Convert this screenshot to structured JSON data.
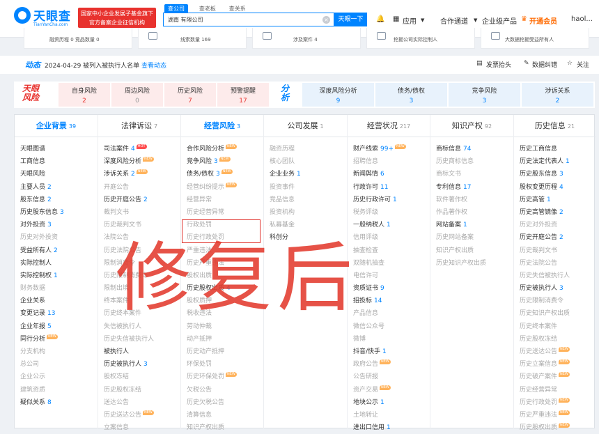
{
  "header": {
    "logo_text": "天眼查",
    "logo_sub": "TianYanCha.com",
    "badge_line1": "国家中小企业发展子基金旗下",
    "badge_line2": "官方备案企业征信机构",
    "search_tabs": [
      "查公司",
      "查老板",
      "查关系"
    ],
    "search_value": "湖南        有限公司",
    "search_button": "天眼一下",
    "nav": [
      "应用",
      "合作通道",
      "企业级产品",
      "开通会员",
      "haol..."
    ]
  },
  "stats": [
    "融资历程 0  竞品数量 0",
    "线索数量 169",
    "涉及案件 4",
    "挖掘公司实际控制人",
    "大数据挖掘受益所有人"
  ],
  "dynamic": {
    "title": "动态",
    "text": "2024-04-29 被列入被执行人名单",
    "link": "查看动态",
    "actions": [
      "发票抬头",
      "数据纠错",
      "关注"
    ]
  },
  "risk": {
    "logo_line1": "天眼",
    "logo_line2": "风险",
    "items": [
      {
        "label": "自身风险",
        "value": "2"
      },
      {
        "label": "周边风险",
        "value": "0"
      },
      {
        "label": "历史风险",
        "value": "7"
      },
      {
        "label": "预警提醒",
        "value": "17"
      }
    ],
    "ana_line1": "分",
    "ana_line2": "析",
    "analysis": [
      {
        "label": "深度风险分析",
        "value": "9"
      },
      {
        "label": "债务/债权",
        "value": "3"
      },
      {
        "label": "竞争风险",
        "value": "3"
      },
      {
        "label": "涉诉关系",
        "value": "2"
      }
    ]
  },
  "columns": [
    {
      "title": "企业背景",
      "count": "39",
      "active": true,
      "items": [
        {
          "t": "天眼图谱"
        },
        {
          "t": "工商信息"
        },
        {
          "t": "天眼风险"
        },
        {
          "t": "主要人员",
          "n": "2"
        },
        {
          "t": "股东信息",
          "n": "2"
        },
        {
          "t": "历史股东信息",
          "n": "3"
        },
        {
          "t": "对外投资",
          "n": "3"
        },
        {
          "t": "历史对外投资",
          "d": true
        },
        {
          "t": "受益所有人",
          "n": "2"
        },
        {
          "t": "实际控制人"
        },
        {
          "t": "实际控制权",
          "n": "1"
        },
        {
          "t": "财务数据",
          "d": true
        },
        {
          "t": "企业关系"
        },
        {
          "t": "变更记录",
          "n": "13"
        },
        {
          "t": "企业年报",
          "n": "5"
        },
        {
          "t": "同行分析",
          "new": true
        },
        {
          "t": "分支机构",
          "d": true
        },
        {
          "t": "总公司",
          "d": true
        },
        {
          "t": "企业公示",
          "d": true
        },
        {
          "t": "建筑资质",
          "d": true
        },
        {
          "t": "疑似关系",
          "n": "8"
        }
      ]
    },
    {
      "title": "法律诉讼",
      "count": "7",
      "items": [
        {
          "t": "司法案件",
          "n": "4",
          "hot": true
        },
        {
          "t": "深度风险分析",
          "new": true
        },
        {
          "t": "涉诉关系",
          "n": "2",
          "new": true
        },
        {
          "t": "开庭公告",
          "d": true
        },
        {
          "t": "历史开庭公告",
          "n": "2"
        },
        {
          "t": "裁判文书",
          "d": true
        },
        {
          "t": "历史裁判文书",
          "d": true
        },
        {
          "t": "法院公告",
          "d": true
        },
        {
          "t": "历史法院公告",
          "d": true
        },
        {
          "t": "限制消费令",
          "d": true
        },
        {
          "t": "历史限制消费令",
          "d": true
        },
        {
          "t": "限制出境",
          "d": true
        },
        {
          "t": "终本案件",
          "d": true
        },
        {
          "t": "历史终本案件",
          "d": true
        },
        {
          "t": "失信被执行人",
          "d": true
        },
        {
          "t": "历史失信被执行人",
          "d": true
        },
        {
          "t": "被执行人"
        },
        {
          "t": "历史被执行人",
          "n": "3"
        },
        {
          "t": "股权冻结",
          "d": true
        },
        {
          "t": "历史股权冻结",
          "d": true
        },
        {
          "t": "送达公告",
          "d": true
        },
        {
          "t": "历史送达公告",
          "d": true,
          "new": true
        },
        {
          "t": "立案信息",
          "d": true
        }
      ]
    },
    {
      "title": "经营风险",
      "count": "3",
      "active": true,
      "items": [
        {
          "t": "合作风险分析",
          "new": true
        },
        {
          "t": "竞争风险",
          "n": "3",
          "new": true
        },
        {
          "t": "债务/债权",
          "n": "3",
          "new": true
        },
        {
          "t": "经营纠纷提示",
          "d": true,
          "new": true
        },
        {
          "t": "经营异常",
          "d": true
        },
        {
          "t": "历史经营异常",
          "d": true
        },
        {
          "t": "行政处罚",
          "d": true
        },
        {
          "t": "历史行政处罚",
          "d": true
        },
        {
          "t": "严重违法",
          "d": true
        },
        {
          "t": "历史严重违法",
          "d": true
        },
        {
          "t": "股权出质",
          "d": true
        },
        {
          "t": "历史股权出质",
          "n": "4"
        },
        {
          "t": "股权质押",
          "d": true
        },
        {
          "t": "税收违法",
          "d": true
        },
        {
          "t": "劳动仲裁",
          "d": true
        },
        {
          "t": "动产抵押",
          "d": true
        },
        {
          "t": "历史动产抵押",
          "d": true
        },
        {
          "t": "环保处罚",
          "d": true
        },
        {
          "t": "历史环保处罚",
          "d": true,
          "new": true
        },
        {
          "t": "欠税公告",
          "d": true
        },
        {
          "t": "历史欠税公告",
          "d": true
        },
        {
          "t": "清算信息",
          "d": true
        },
        {
          "t": "知识产权出质",
          "d": true
        }
      ]
    },
    {
      "title": "公司发展",
      "count": "1",
      "items": [
        {
          "t": "融资历程",
          "d": true
        },
        {
          "t": "核心团队",
          "d": true
        },
        {
          "t": "企业业务",
          "n": "1"
        },
        {
          "t": "投资事件",
          "d": true
        },
        {
          "t": "竞品信息",
          "d": true
        },
        {
          "t": "投资机构",
          "d": true
        },
        {
          "t": "私募基金",
          "d": true
        },
        {
          "t": "科创分"
        }
      ]
    },
    {
      "title": "经营状况",
      "count": "217",
      "items": [
        {
          "t": "财产线索",
          "n": "99+",
          "new": true
        },
        {
          "t": "招聘信息",
          "d": true
        },
        {
          "t": "新闻舆情",
          "n": "6"
        },
        {
          "t": "行政许可",
          "n": "11"
        },
        {
          "t": "历史行政许可",
          "n": "1"
        },
        {
          "t": "税务评级",
          "d": true
        },
        {
          "t": "一般纳税人",
          "n": "1"
        },
        {
          "t": "信用评级",
          "d": true
        },
        {
          "t": "抽查检查",
          "d": true
        },
        {
          "t": "双随机抽查",
          "d": true
        },
        {
          "t": "电信许可",
          "d": true
        },
        {
          "t": "资质证书",
          "n": "9"
        },
        {
          "t": "招投标",
          "n": "14"
        },
        {
          "t": "产品信息",
          "d": true
        },
        {
          "t": "微信公众号",
          "d": true
        },
        {
          "t": "微博",
          "d": true
        },
        {
          "t": "抖音/快手",
          "n": "1"
        },
        {
          "t": "政府公告",
          "d": true,
          "new": true
        },
        {
          "t": "公告研报",
          "d": true
        },
        {
          "t": "资产交易",
          "d": true,
          "new": true
        },
        {
          "t": "地块公示",
          "n": "1"
        },
        {
          "t": "土地转让",
          "d": true
        },
        {
          "t": "进出口信用",
          "n": "1"
        }
      ]
    },
    {
      "title": "知识产权",
      "count": "92",
      "items": [
        {
          "t": "商标信息",
          "n": "74"
        },
        {
          "t": "历史商标信息",
          "d": true
        },
        {
          "t": "商标文书",
          "d": true
        },
        {
          "t": "专利信息",
          "n": "17"
        },
        {
          "t": "软件著作权",
          "d": true
        },
        {
          "t": "作品著作权",
          "d": true
        },
        {
          "t": "网站备案",
          "n": "1"
        },
        {
          "t": "历史网站备案",
          "d": true
        },
        {
          "t": "知识产权出质",
          "d": true
        },
        {
          "t": "历史知识产权出质",
          "d": true
        }
      ]
    },
    {
      "title": "历史信息",
      "count": "21",
      "items": [
        {
          "t": "历史工商信息"
        },
        {
          "t": "历史法定代表人",
          "n": "1"
        },
        {
          "t": "历史股东信息",
          "n": "3"
        },
        {
          "t": "股权变更历程",
          "n": "4"
        },
        {
          "t": "历史高管",
          "n": "1"
        },
        {
          "t": "历史高管镜像",
          "n": "2"
        },
        {
          "t": "历史对外投资",
          "d": true
        },
        {
          "t": "历史开庭公告",
          "n": "2"
        },
        {
          "t": "历史裁判文书",
          "d": true
        },
        {
          "t": "历史法院公告",
          "d": true
        },
        {
          "t": "历史失信被执行人",
          "d": true
        },
        {
          "t": "历史被执行人",
          "n": "3"
        },
        {
          "t": "历史限制消费令",
          "d": true
        },
        {
          "t": "历史知识产权出质",
          "d": true
        },
        {
          "t": "历史终本案件",
          "d": true
        },
        {
          "t": "历史股权冻结",
          "d": true
        },
        {
          "t": "历史送达公告",
          "d": true,
          "new": true
        },
        {
          "t": "历史立案信息",
          "d": true,
          "new": true
        },
        {
          "t": "历史破产案件",
          "d": true,
          "new": true
        },
        {
          "t": "历史经营异常",
          "d": true
        },
        {
          "t": "历史行政处罚",
          "d": true,
          "new": true
        },
        {
          "t": "历史严重违法",
          "d": true,
          "new": true
        },
        {
          "t": "历史股权出质",
          "d": true,
          "new": true
        }
      ]
    }
  ],
  "labels": {
    "new": "NEW",
    "hot": "HOT"
  },
  "watermark": "修复后",
  "colors": {
    "brand": "#0084ff",
    "risk_red": "#e8322e",
    "watermark": "#e23a2d"
  }
}
